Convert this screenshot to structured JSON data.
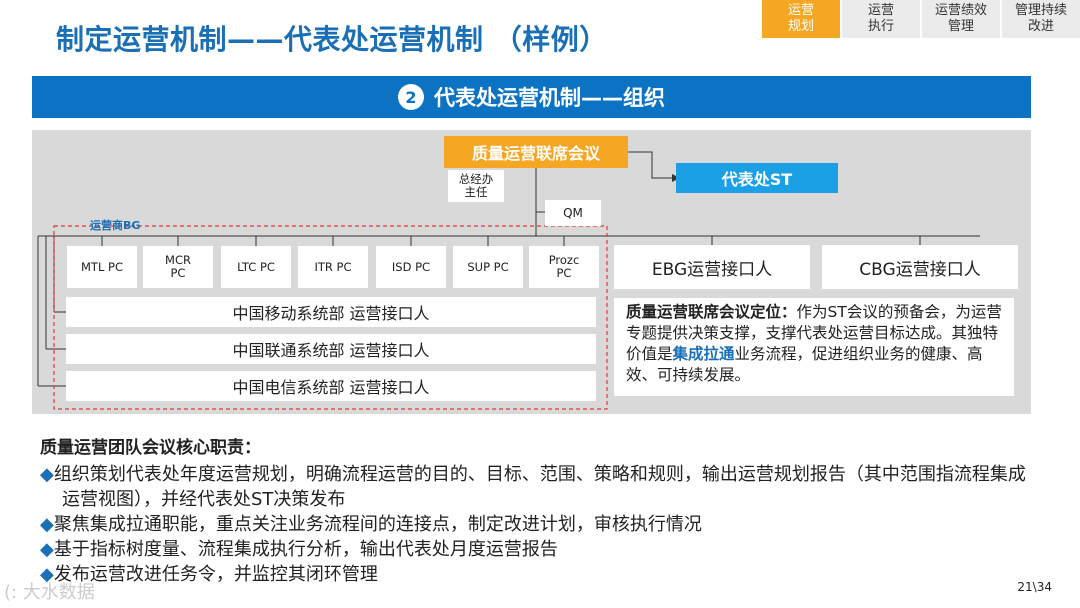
{
  "title": "制定运营机制——代表处运营机制 （样例）",
  "tabs": [
    {
      "label": "运营\n规划",
      "active": true
    },
    {
      "label": "运营\n执行",
      "active": false
    },
    {
      "label": "运营绩效\n管理",
      "active": false
    },
    {
      "label": "管理持续\n改进",
      "active": false
    }
  ],
  "banner": {
    "number": "2",
    "text": "代表处运营机制——组织"
  },
  "org": {
    "meeting": "质量运营联席会议",
    "st": "代表处ST",
    "director": "总经办\n主任",
    "qm": "QM",
    "bg_label": "运营商BG",
    "pcs": [
      "MTL PC",
      "MCR\nPC",
      "LTC PC",
      "ITR PC",
      "ISD PC",
      "SUP PC",
      "Prozc\nPC"
    ],
    "ebg": "EBG运营接口人",
    "cbg": "CBG运营接口人",
    "rows": [
      "中国移动系统部   运营接口人",
      "中国联通系统部   运营接口人",
      "中国电信系统部   运营接口人"
    ]
  },
  "positioning": {
    "label": "质量运营联席会议定位：",
    "text1": "作为ST会议的预备会，为运营专题提供决策支撑，支撑代表处运营目标达成。其独特价值是",
    "highlight": "集成拉通",
    "text2": "业务流程，促进组织业务的健康、高效、可持续发展。"
  },
  "duties": {
    "title": "质量运营团队会议核心职责：",
    "bullet_symbol": "◆",
    "items": [
      "组织策划代表处年度运营规划，明确流程运营的目的、目标、范围、策略和规则，输出运营规划报告（其中范围指流程集成运营视图），并经代表处ST决策发布",
      "聚焦集成拉通职能，重点关注业务流程间的连接点，制定改进计划，审核执行情况",
      "基于指标树度量、流程集成执行分析，输出代表处月度运营报告",
      "发布运营改进任务令，并监控其闭环管理"
    ]
  },
  "page_number": "21\\34",
  "watermark": "(: 大水数据",
  "colors": {
    "accent_blue": "#0b72c4",
    "title_blue": "#1a6fb5",
    "orange": "#f5a623",
    "st_blue": "#1ba0e6",
    "dash_red": "#e03a3a"
  }
}
